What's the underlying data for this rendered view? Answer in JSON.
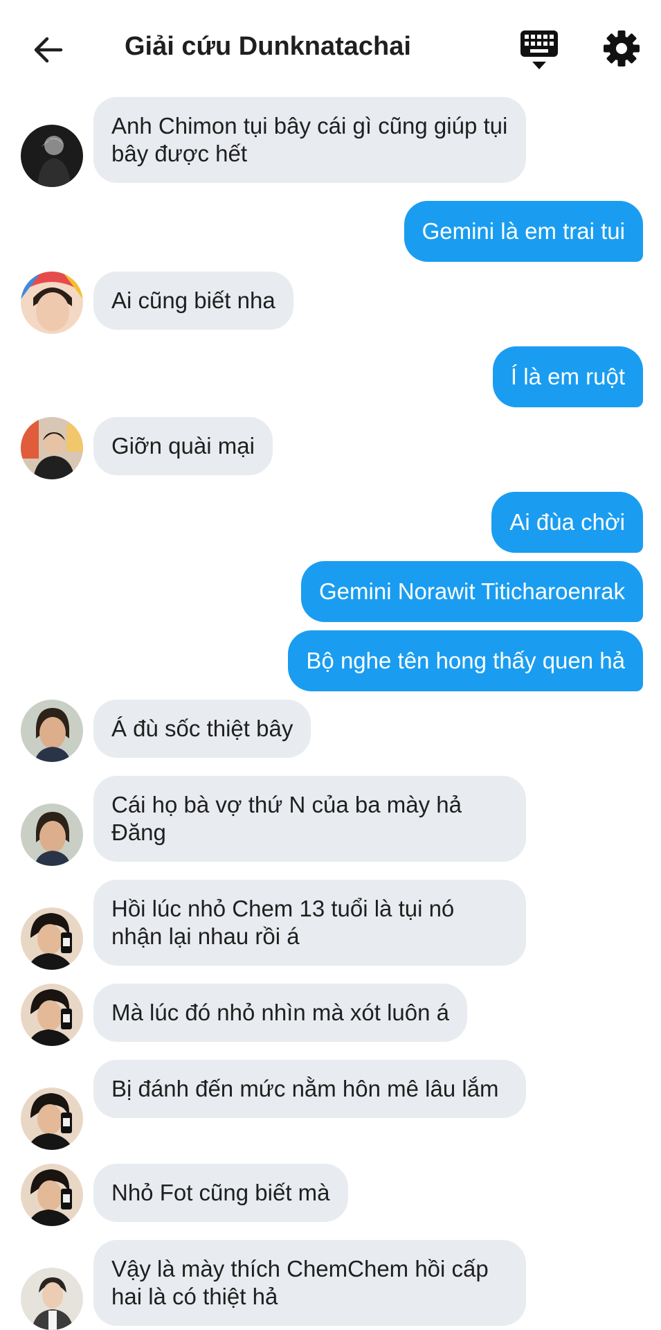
{
  "header": {
    "title": "Giải cứu Dunknatachai"
  },
  "colors": {
    "incoming_bubble": "#e8ebef",
    "outgoing_bubble": "#1a9df0"
  },
  "messages": [
    {
      "direction": "in",
      "avatar": "avatar-1",
      "text": "Anh Chimon tụi bây cái gì cũng giúp tụi bây được hết"
    },
    {
      "direction": "out",
      "text": "Gemini là em trai tui"
    },
    {
      "direction": "in",
      "avatar": "avatar-2",
      "text": "Ai cũng biết nha"
    },
    {
      "direction": "out",
      "text": "Í là em ruột"
    },
    {
      "direction": "in",
      "avatar": "avatar-3",
      "text": "Giỡn quài mại"
    },
    {
      "direction": "out",
      "text": "Ai đùa chời"
    },
    {
      "direction": "out",
      "text": "Gemini Norawit Titicharoenrak"
    },
    {
      "direction": "out",
      "text": "Bộ nghe tên hong thấy quen hả"
    },
    {
      "direction": "in",
      "avatar": "avatar-4",
      "text": "Á đù sốc thiệt bây"
    },
    {
      "direction": "in",
      "avatar": "avatar-4",
      "text": "Cái họ bà vợ thứ N của ba mày hả Đăng"
    },
    {
      "direction": "in",
      "avatar": "avatar-5",
      "text": "Hồi lúc nhỏ Chem 13 tuổi là tụi nó nhận lại nhau rồi á"
    },
    {
      "direction": "in",
      "avatar": "avatar-5",
      "text": "Mà lúc đó nhỏ nhìn mà xót luôn á"
    },
    {
      "direction": "in",
      "avatar": "avatar-5",
      "text": "Bị đánh đến mức nằm hôn mê lâu lắm"
    },
    {
      "direction": "in",
      "avatar": "avatar-5",
      "text": "Nhỏ Fot cũng biết mà"
    },
    {
      "direction": "in",
      "avatar": "avatar-6",
      "text": "Vậy là mày thích ChemChem hồi cấp hai là có thiệt hả"
    }
  ]
}
